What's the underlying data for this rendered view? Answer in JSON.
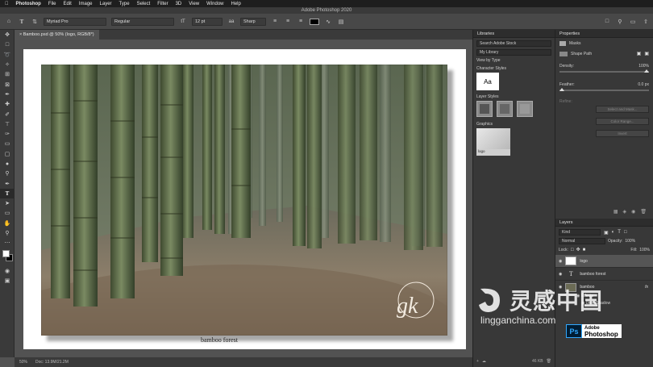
{
  "menubar": {
    "items": [
      "Photoshop",
      "File",
      "Edit",
      "Image",
      "Layer",
      "Type",
      "Select",
      "Filter",
      "3D",
      "View",
      "Window",
      "Help"
    ]
  },
  "window": {
    "title": "Adobe Photoshop 2020"
  },
  "options": {
    "font_family": "Myriad Pro",
    "font_style": "Regular",
    "font_size": "12 pt",
    "antialias": "Sharp",
    "text_color": "#000000"
  },
  "document": {
    "tab_title": "Bamboo.psd @ 50% (logo, RGB/8*)",
    "caption": "bamboo forest",
    "signature": "gk"
  },
  "status": {
    "zoom": "50%",
    "doc_info": "Doc: 13.9M/21.2M"
  },
  "libraries": {
    "title": "Libraries",
    "search_placeholder": "Search Adobe Stock",
    "library_name": "My Library",
    "view_by": "View by Type",
    "sections": {
      "character_styles": "Character Styles",
      "layer_styles": "Layer Styles",
      "graphics": "Graphics"
    },
    "char_sample": "Aa",
    "graphic_label": "logo",
    "footer_size": "46 KB"
  },
  "properties": {
    "title": "Properties",
    "masks_label": "Masks",
    "shape_path_label": "Shape Path",
    "density_label": "Density:",
    "density_value": "100%",
    "feather_label": "Feather:",
    "feather_value": "0.0 px",
    "refine_label": "Refine:",
    "buttons": [
      "Select and Mask...",
      "Color Range...",
      "Invert"
    ]
  },
  "layers": {
    "title": "Layers",
    "filter": "Kind",
    "blend_mode": "Normal",
    "opacity_label": "Opacity:",
    "opacity_value": "100%",
    "lock_label": "Lock:",
    "fill_label": "Fill:",
    "fill_value": "100%",
    "items": [
      {
        "name": "logo"
      },
      {
        "name": "bamboo forest"
      },
      {
        "name": "bamboo"
      }
    ],
    "effects_label": "Effects",
    "drop_shadow_label": "Drop Shadow",
    "fx_label": "fx"
  },
  "watermark": {
    "site": "lingganchina.com",
    "cn_text": "灵感中国",
    "ps_badge": "Ps",
    "adobe_text": "Adobe",
    "photoshop_text": "Photoshop"
  }
}
